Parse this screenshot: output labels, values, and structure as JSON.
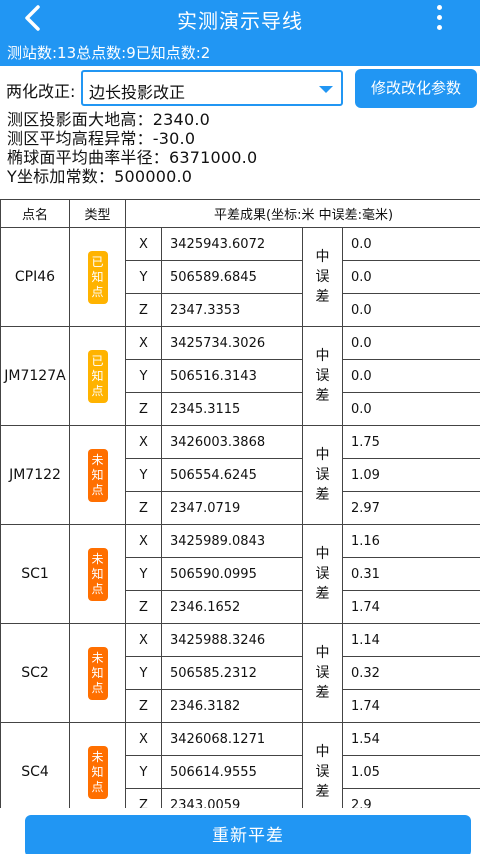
{
  "header": {
    "title": "实测演示导线",
    "stats": "测站数:13总点数:9已知点数:2"
  },
  "correction": {
    "label": "两化改正:",
    "selected": "边长投影改正",
    "button": "修改改化参数"
  },
  "params": [
    "测区投影面大地高：2340.0",
    "测区平均高程异常：-30.0",
    "椭球面平均曲率半径：6371000.0",
    "Y坐标加常数：500000.0"
  ],
  "table": {
    "headers": {
      "name": "点名",
      "type": "类型",
      "result": "平差成果(坐标:米 中误差:毫米)"
    },
    "error_label": "中误差",
    "axes": [
      "X",
      "Y",
      "Z"
    ],
    "rows": [
      {
        "name": "CPI46",
        "type": "已知点",
        "known": true,
        "coords": [
          "3425943.6072",
          "506589.6845",
          "2347.3353"
        ],
        "errors": [
          "0.0",
          "0.0",
          "0.0"
        ]
      },
      {
        "name": "JM7127A",
        "type": "已知点",
        "known": true,
        "coords": [
          "3425734.3026",
          "506516.3143",
          "2345.3115"
        ],
        "errors": [
          "0.0",
          "0.0",
          "0.0"
        ]
      },
      {
        "name": "JM7122",
        "type": "未知点",
        "known": false,
        "coords": [
          "3426003.3868",
          "506554.6245",
          "2347.0719"
        ],
        "errors": [
          "1.75",
          "1.09",
          "2.97"
        ]
      },
      {
        "name": "SC1",
        "type": "未知点",
        "known": false,
        "coords": [
          "3425989.0843",
          "506590.0995",
          "2346.1652"
        ],
        "errors": [
          "1.16",
          "0.31",
          "1.74"
        ]
      },
      {
        "name": "SC2",
        "type": "未知点",
        "known": false,
        "coords": [
          "3425988.3246",
          "506585.2312",
          "2346.3182"
        ],
        "errors": [
          "1.14",
          "0.32",
          "1.74"
        ]
      },
      {
        "name": "SC4",
        "type": "未知点",
        "known": false,
        "coords": [
          "3426068.1271",
          "506614.9555",
          "2343.0059"
        ],
        "errors": [
          "1.54",
          "1.05",
          "2.9"
        ]
      }
    ]
  },
  "footer": {
    "button": "重新平差"
  },
  "colors": {
    "primary": "#2196F3",
    "known_badge": "#FFB300",
    "unknown_badge": "#FF6F00"
  }
}
